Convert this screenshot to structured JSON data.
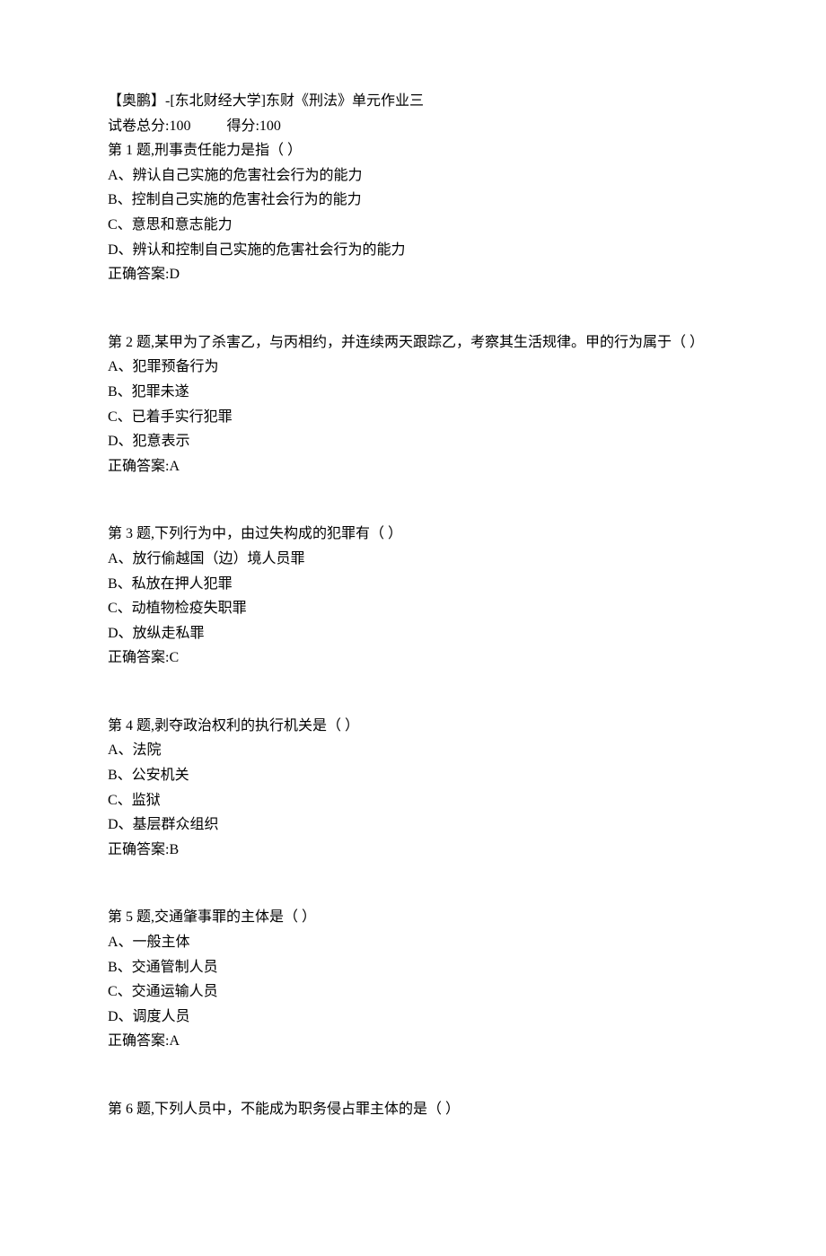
{
  "header": {
    "title": "【奥鹏】-[东北财经大学]东财《刑法》单元作业三",
    "totalScoreLabel": "试卷总分:",
    "totalScore": "100",
    "gotScoreLabel": "得分:",
    "gotScore": "100"
  },
  "answerPrefix": "正确答案:",
  "questions": [
    {
      "stem": "第 1 题,刑事责任能力是指（           ）",
      "options": [
        "A、辨认自己实施的危害社会行为的能力",
        "B、控制自己实施的危害社会行为的能力",
        "C、意思和意志能力",
        "D、辨认和控制自己实施的危害社会行为的能力"
      ],
      "answer": "D"
    },
    {
      "stem": "第 2 题,某甲为了杀害乙，与丙相约，并连续两天跟踪乙，考察其生活规律。甲的行为属于（         ）",
      "options": [
        "A、犯罪预备行为",
        "B、犯罪未遂",
        "C、已着手实行犯罪",
        "D、犯意表示"
      ],
      "answer": "A"
    },
    {
      "stem": "第 3 题,下列行为中，由过失构成的犯罪有（      ）",
      "options": [
        "A、放行偷越国（边）境人员罪",
        "B、私放在押人犯罪",
        "C、动植物检疫失职罪",
        "D、放纵走私罪"
      ],
      "answer": "C"
    },
    {
      "stem": "第 4 题,剥夺政治权利的执行机关是（              ）",
      "options": [
        "A、法院",
        "B、公安机关",
        "C、监狱",
        "D、基层群众组织"
      ],
      "answer": "B"
    },
    {
      "stem": "第 5 题,交通肇事罪的主体是（     ）",
      "options": [
        "A、一般主体",
        "B、交通管制人员",
        "C、交通运输人员",
        "D、调度人员"
      ],
      "answer": "A"
    },
    {
      "stem": "第 6 题,下列人员中，不能成为职务侵占罪主体的是（       ）",
      "options": [],
      "answer": null
    }
  ]
}
